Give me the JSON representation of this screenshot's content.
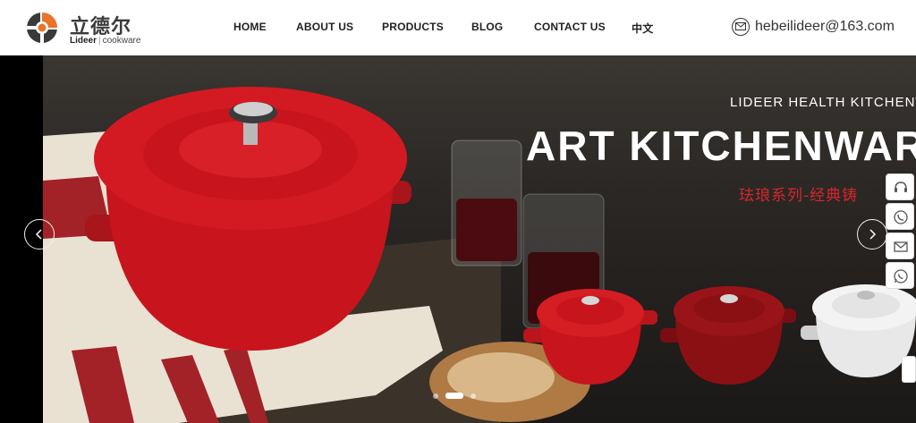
{
  "brand": {
    "name_cn": "立德尔",
    "name_en_bold": "Lideer",
    "name_en_rest": "cookware",
    "separator": "|"
  },
  "nav": {
    "items": [
      {
        "label": "HOME"
      },
      {
        "label": "ABOUT US"
      },
      {
        "label": "PRODUCTS"
      },
      {
        "label": "BLOG"
      },
      {
        "label": "CONTACT US"
      },
      {
        "label": "中文"
      }
    ]
  },
  "contact": {
    "email": "hebeilideer@163.com",
    "icon": "envelope-icon"
  },
  "banner": {
    "subtitle": "LIDEER HEALTH KITCHENWA",
    "title": "ART KITCHENWAR",
    "subtitle_cn": "珐琅系列-经典铸",
    "slides_total": 3,
    "active_slide": 2,
    "prev_icon": "chevron-left-icon",
    "next_icon": "chevron-right-icon"
  },
  "side_tools": [
    {
      "icon": "customer-service-icon"
    },
    {
      "icon": "phone-icon"
    },
    {
      "icon": "mail-icon"
    },
    {
      "icon": "whatsapp-icon"
    }
  ],
  "colors": {
    "pot_red": "#c8141c",
    "pot_burgundy": "#8a1014",
    "pot_white": "#e8e8e8",
    "accent_red": "#d8262b",
    "header_text": "#222222"
  }
}
